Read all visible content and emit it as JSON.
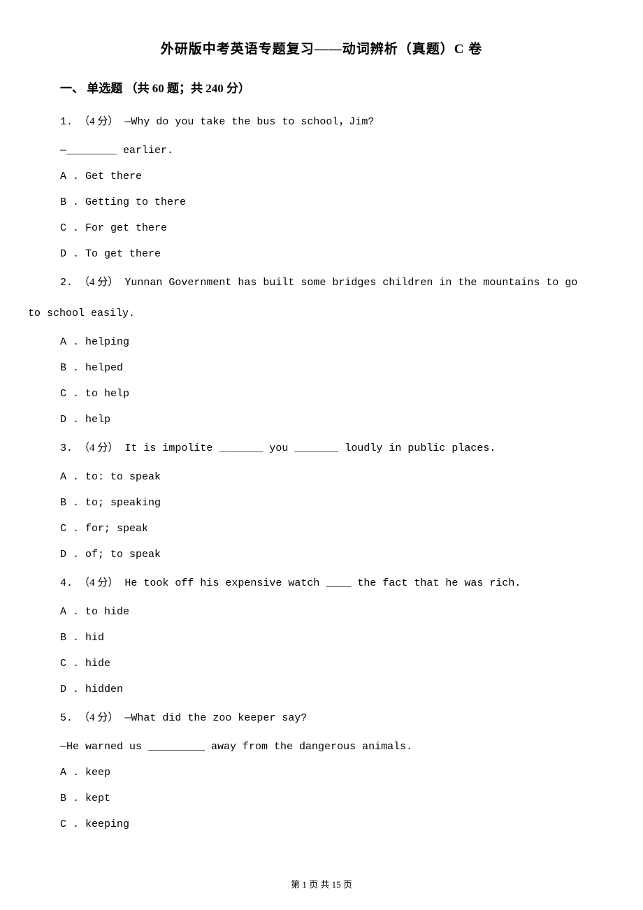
{
  "title": "外研版中考英语专题复习——动词辨析（真题）C 卷",
  "section_header": "一、 单选题 （共 60 题；共 240 分）",
  "questions": [
    {
      "number": "1.",
      "points": "（4 分）",
      "text": "—Why do you take the bus to school，Jim?",
      "followup": "—________ earlier.",
      "options": [
        "A . Get there",
        "B . Getting to there",
        "C . For get there",
        "D . To get there"
      ]
    },
    {
      "number": "2.",
      "points": "（4 分）",
      "text_before": "Yunnan Government has built some bridges             children in the mountains to go",
      "text_wrap": "to school easily.",
      "options": [
        "A . helping",
        "B . helped",
        "C . to help",
        "D . help"
      ]
    },
    {
      "number": "3.",
      "points": "（4 分）",
      "text": "It is impolite _______ you _______ loudly in public places.",
      "options": [
        "A . to: to speak",
        "B . to; speaking",
        "C . for; speak",
        "D . of; to speak"
      ]
    },
    {
      "number": "4.",
      "points": "（4 分）",
      "text": "He took off his expensive watch ____ the fact that he was rich.",
      "options": [
        "A . to hide",
        "B . hid",
        "C . hide",
        "D . hidden"
      ]
    },
    {
      "number": "5.",
      "points": "（4 分）",
      "text": "—What did the zoo keeper say?",
      "followup": "—He warned us _________ away from the dangerous animals.",
      "options": [
        "A . keep",
        "B . kept",
        "C . keeping"
      ]
    }
  ],
  "footer": "第 1 页 共 15 页"
}
